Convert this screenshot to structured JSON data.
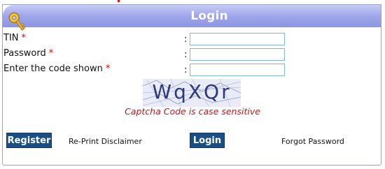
{
  "header": {
    "title": "Login",
    "icon": "key-icon"
  },
  "form": {
    "tin_label": "TIN",
    "password_label": "Password",
    "code_label": "Enter the code shown",
    "required_mark": "*",
    "colon": ":",
    "tin_value": "",
    "password_value": "",
    "code_value": ""
  },
  "captcha": {
    "text": "WqXQr",
    "note": "Captcha Code is case sensitive"
  },
  "actions": {
    "register_label": "Register",
    "reprint_label": "Re-Print Disclaimer",
    "login_label": "Login",
    "forgot_label": "Forgot Password"
  },
  "colors": {
    "header_gradient": "#9ea5ea",
    "button": "#1a4f86",
    "required": "#d40000",
    "note": "#c3161c"
  }
}
